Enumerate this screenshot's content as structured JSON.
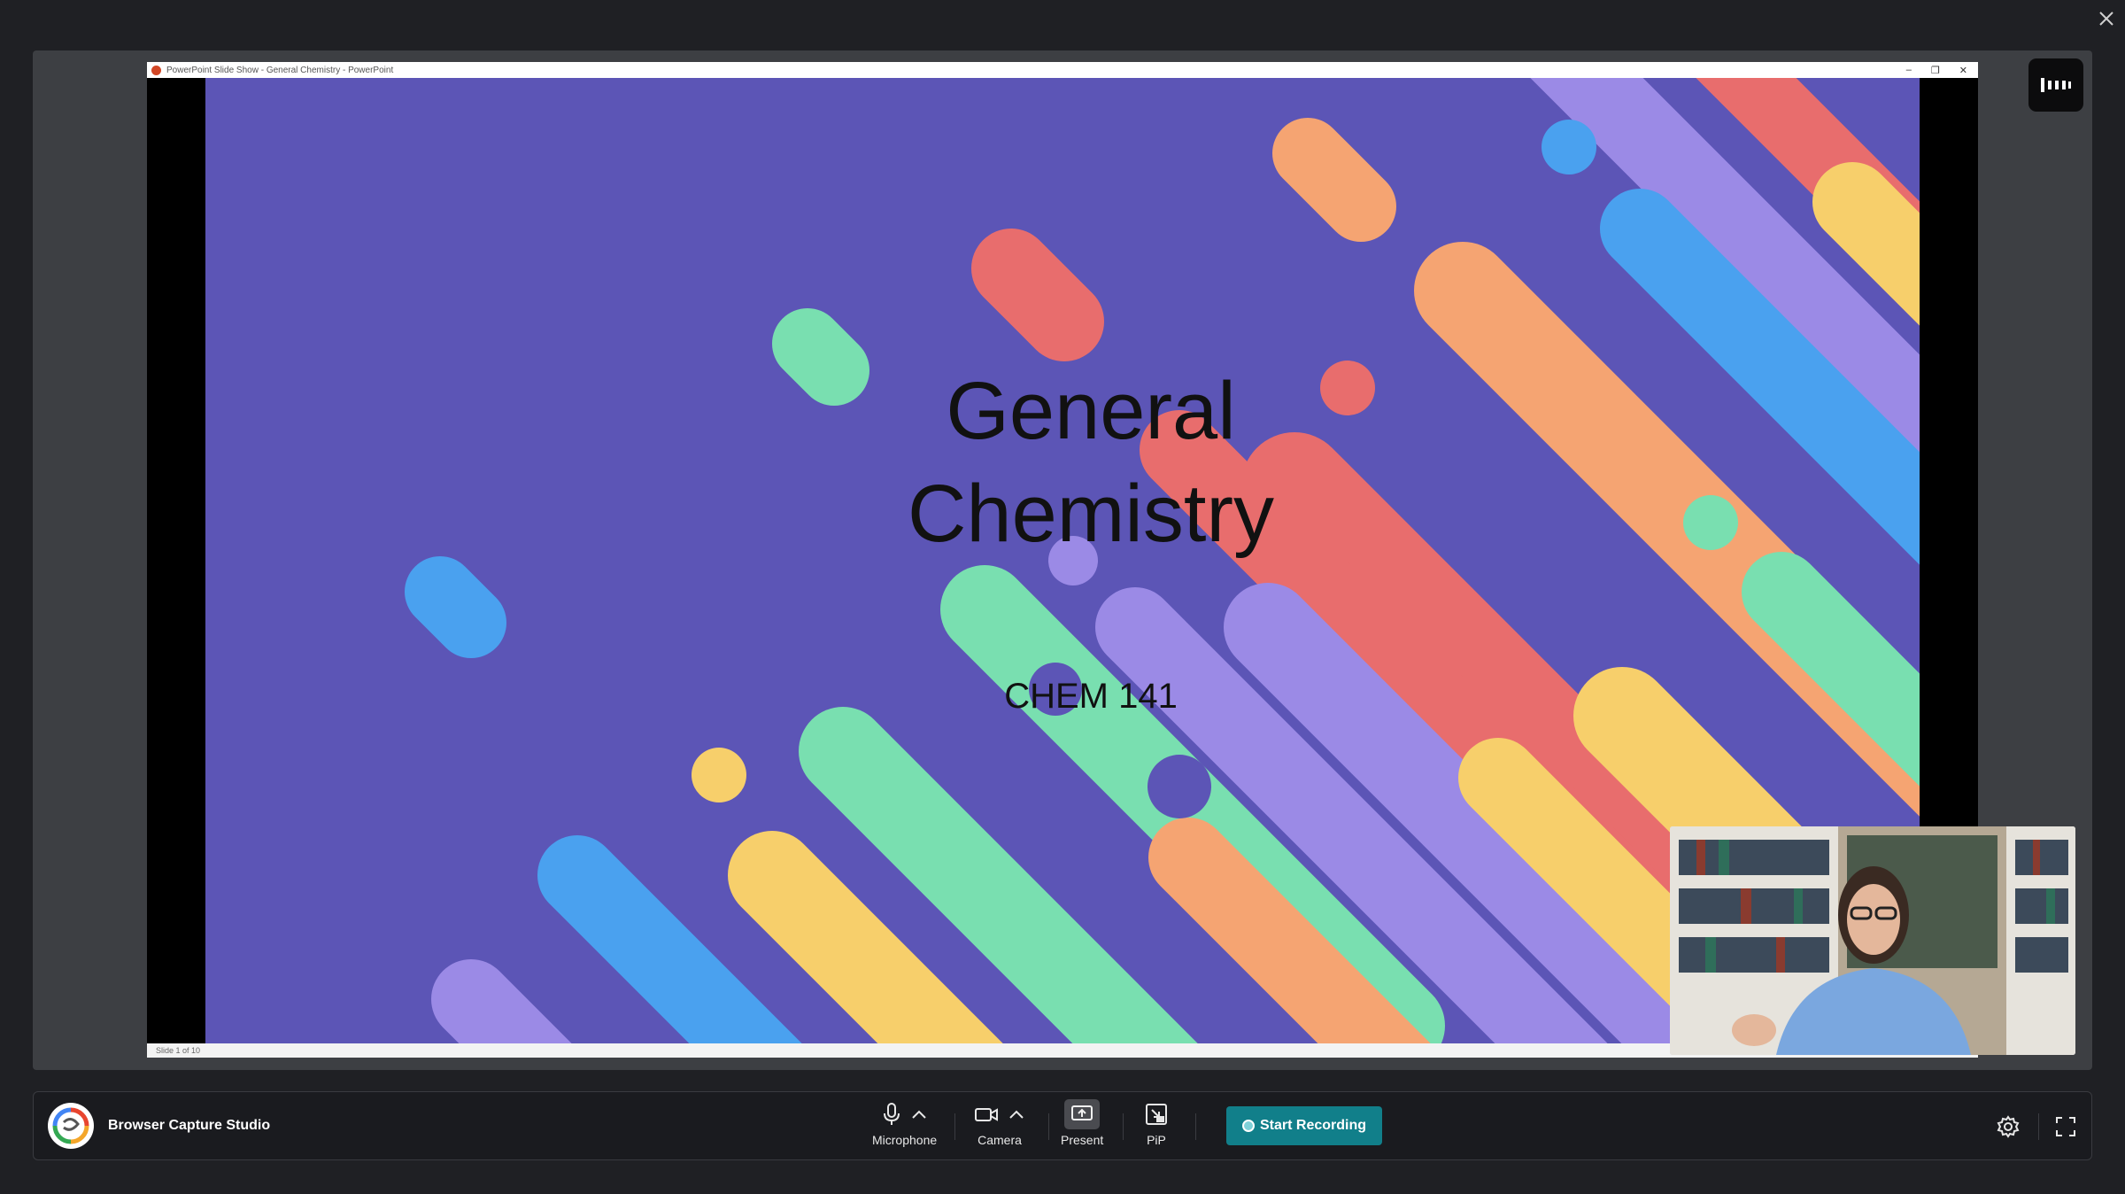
{
  "app": {
    "name": "Browser Capture Studio"
  },
  "shared_window": {
    "title": "PowerPoint Slide Show  -  General Chemistry - PowerPoint",
    "status": "Slide 1 of 10",
    "controls": [
      "–",
      "❐",
      "✕"
    ]
  },
  "slide": {
    "title_line1": "General",
    "title_line2": "Chemistry",
    "subtitle": "CHEM 141",
    "background": "#5c55b6"
  },
  "controls": {
    "microphone": "Microphone",
    "camera": "Camera",
    "present": "Present",
    "pip": "PiP",
    "start_recording": "Start Recording"
  },
  "icons": {
    "close": "close-icon",
    "sidebar": "audio-levels-icon",
    "microphone": "microphone-icon",
    "camera": "camera-icon",
    "present": "present-screen-icon",
    "pip": "pip-icon",
    "settings": "gear-icon",
    "fullscreen": "fullscreen-icon"
  },
  "colors": {
    "accent": "#117f8a",
    "bar_background": "#1a1b1f",
    "stage_background": "#3d3f43"
  }
}
